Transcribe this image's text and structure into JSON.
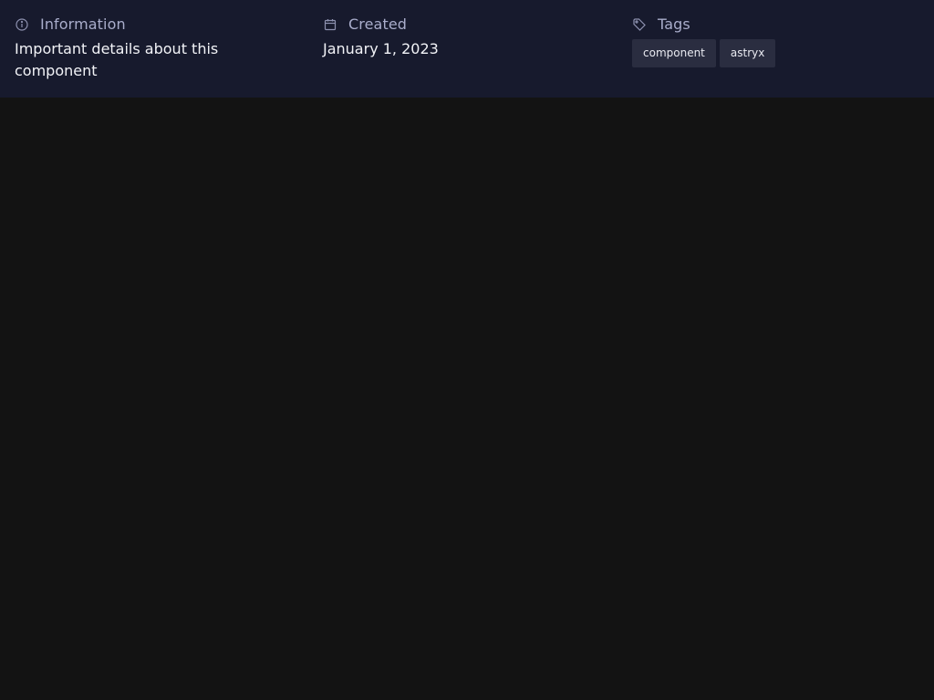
{
  "info_panel": {
    "information": {
      "icon": "info-icon",
      "title": "Information",
      "value": "Important details about this component"
    },
    "created": {
      "icon": "calendar-icon",
      "title": "Created",
      "value": "January 1, 2023"
    },
    "tags": {
      "icon": "tag-icon",
      "title": "Tags",
      "items": [
        {
          "label": "component"
        },
        {
          "label": "astryx"
        }
      ]
    }
  },
  "colors": {
    "page_background": "#131313",
    "panel_background": "#171a2d",
    "title_text": "#a9adcb",
    "value_text": "#f2f3f7",
    "tag_background": "#2a2d40"
  }
}
